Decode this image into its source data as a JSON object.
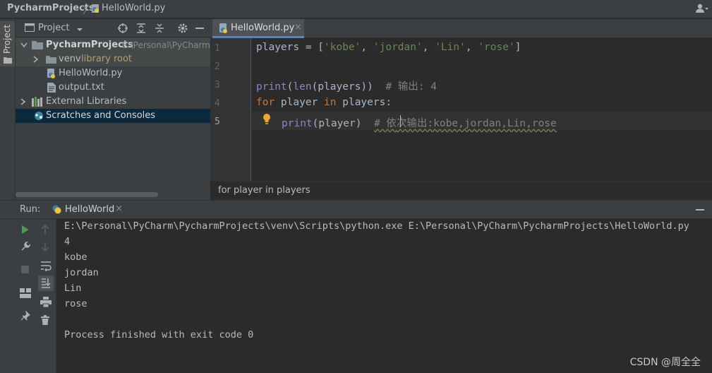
{
  "titlebar": {
    "project": "PycharmProjects",
    "separator": "〉",
    "file": "HelloWorld.py"
  },
  "side_tab": {
    "label": "Project"
  },
  "project_panel": {
    "title": "Project",
    "root": {
      "name": "PycharmProjects",
      "path": "E:\\Personal\\PyCharm\\"
    },
    "venv": {
      "name": "venv",
      "note": "library root"
    },
    "files": [
      "HelloWorld.py",
      "output.txt"
    ],
    "external": "External Libraries",
    "scratches": "Scratches and Consoles"
  },
  "editor": {
    "tab": "HelloWorld.py",
    "line_numbers": [
      "1",
      "2",
      "3",
      "4",
      "5"
    ],
    "line1": {
      "ident": "players = [",
      "s1": "'kobe'",
      "c1": ", ",
      "s2": "'jordan'",
      "c2": ", ",
      "s3": "'Lin'",
      "c3": ", ",
      "s4": "'rose'",
      "end": "]"
    },
    "line3": {
      "fn": "print",
      "p1": "(",
      "fn2": "len",
      "rest": "(players))  ",
      "comment": "# 输出: 4"
    },
    "line4": {
      "kw": "for",
      "mid": " player ",
      "kw2": "in",
      "rest": " players:"
    },
    "line5": {
      "fn": "print",
      "rest": "(player)  ",
      "comment_a": "# 依",
      "comment_b": "次输出:kobe,jordan,Lin,rose"
    },
    "breadcrumb": "for player in players"
  },
  "run": {
    "label": "Run:",
    "tab": "HelloWorld",
    "output": [
      "E:\\Personal\\PyCharm\\PycharmProjects\\venv\\Scripts\\python.exe E:\\Personal\\PyCharm\\PycharmProjects\\HelloWorld.py",
      "4",
      "kobe",
      "jordan",
      "Lin",
      "rose",
      "",
      "Process finished with exit code 0"
    ]
  },
  "watermark": "CSDN @周全全",
  "colors": {
    "accent": "#4a88c7",
    "keyword": "#cc7832",
    "string": "#6a8759",
    "builtin": "#8888c6",
    "comment": "#808080"
  }
}
